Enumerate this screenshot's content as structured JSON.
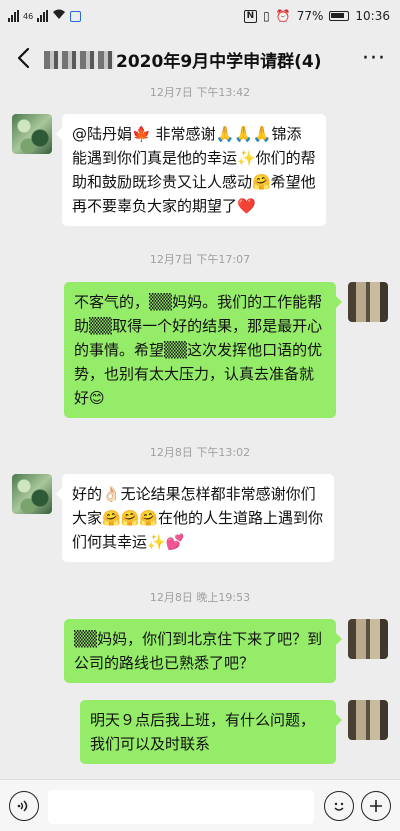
{
  "status_bar": {
    "signal_label": "46",
    "battery": "77%",
    "time": "10:36"
  },
  "header": {
    "title": "2020年9月中学申请群(4)",
    "more": "···"
  },
  "messages": [
    {
      "time": "12月7日 下午13:42"
    },
    {
      "text": "@陆丹娟🍁 非常感谢🙏🙏🙏锦添能遇到你们真是他的幸运✨你们的帮助和鼓励既珍贵又让人感动🤗希望他再不要辜负大家的期望了❤️"
    },
    {
      "time": "12月7日 下午17:07"
    },
    {
      "text": "不客气的，▒▒妈妈。我们的工作能帮助▒▒取得一个好的结果，那是最开心的事情。希望▒▒这次发挥他口语的优势，也别有太大压力，认真去准备就好😊"
    },
    {
      "time": "12月8日 下午13:02"
    },
    {
      "text": "好的👌🏻无论结果怎样都非常感谢你们大家🤗🤗🤗在他的人生道路上遇到你们何其幸运✨💕"
    },
    {
      "time": "12月8日 晚上19:53"
    },
    {
      "text": "▒▒妈妈，你们到北京住下来了吧？到公司的路线也已熟悉了吧？"
    },
    {
      "text": "明天９点后我上班，有什么问题，我们可以及时联系"
    }
  ]
}
